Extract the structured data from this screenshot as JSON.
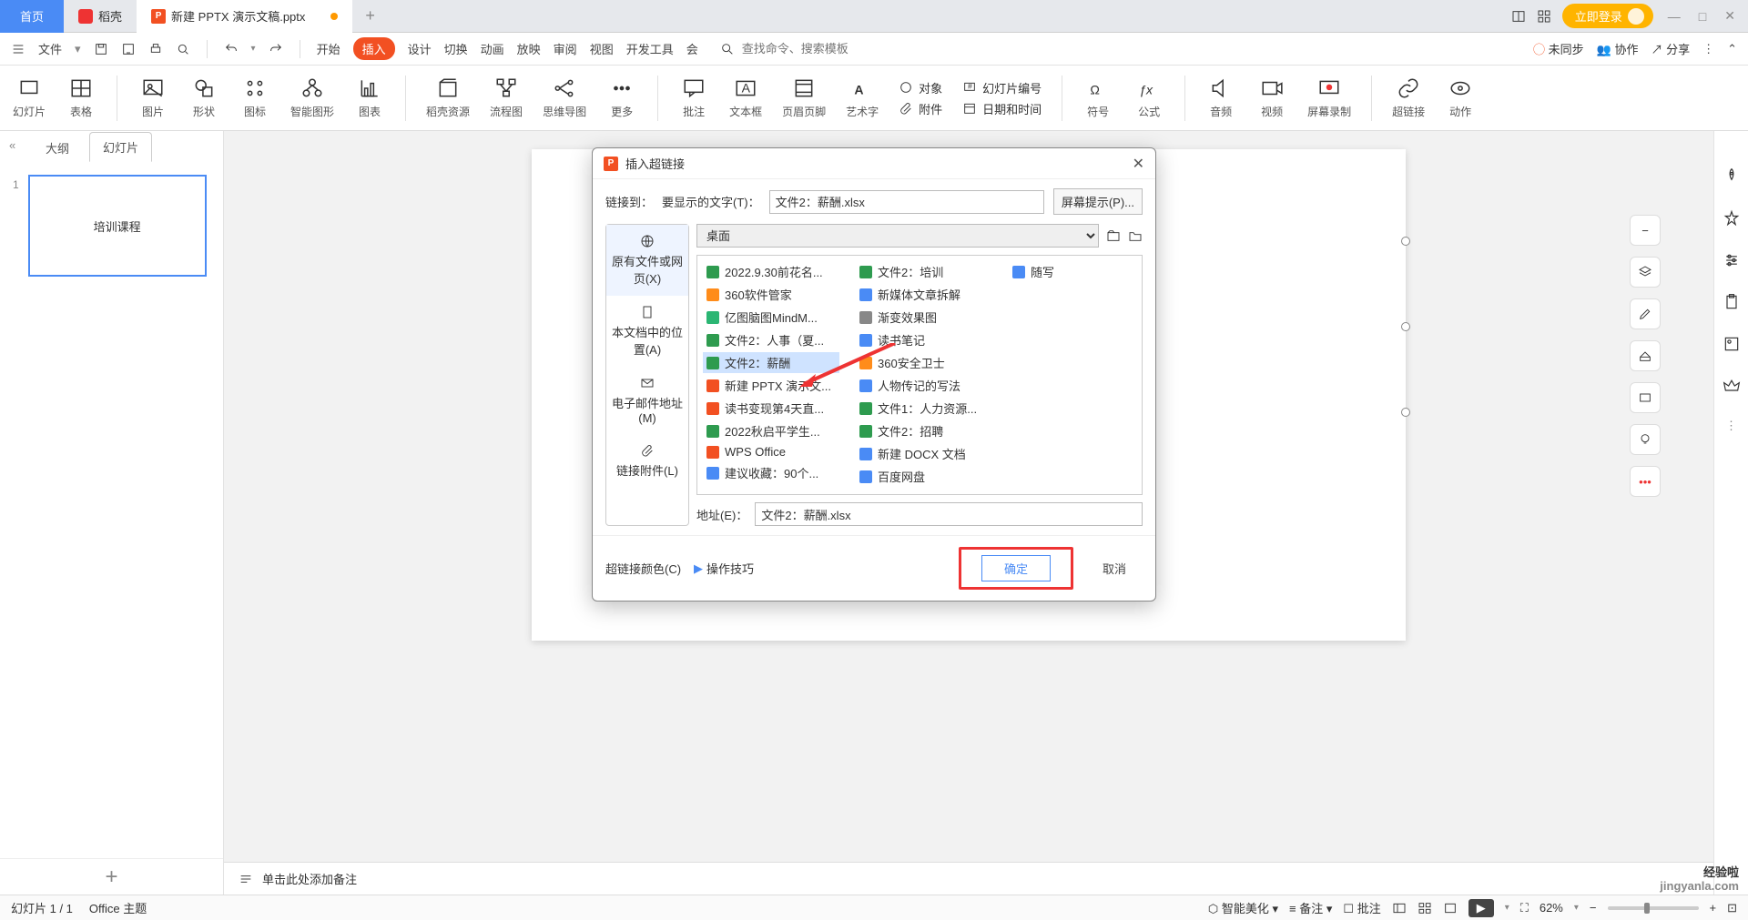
{
  "tabs": {
    "home": "首页",
    "docer": "稻壳",
    "doc": "新建 PPTX 演示文稿.pptx"
  },
  "titlebar": {
    "login": "立即登录"
  },
  "menu": {
    "file": "文件",
    "start": "开始",
    "insert": "插入",
    "design": "设计",
    "transition": "切换",
    "anim": "动画",
    "show": "放映",
    "review": "审阅",
    "view": "视图",
    "dev": "开发工具",
    "member": "会",
    "search_ph": "查找命令、搜索模板",
    "unsynced": "未同步",
    "collab": "协作",
    "share": "分享"
  },
  "ribbon": {
    "slide": "幻灯片",
    "table": "表格",
    "picture": "图片",
    "shape": "形状",
    "icon": "图标",
    "smart": "智能图形",
    "chart": "图表",
    "docer": "稻壳资源",
    "flow": "流程图",
    "mind": "思维导图",
    "more": "更多",
    "comment": "批注",
    "textbox": "文本框",
    "header": "页眉页脚",
    "wordart": "艺术字",
    "object": "对象",
    "slidenum": "幻灯片编号",
    "attach": "附件",
    "datetime": "日期和时间",
    "symbol": "符号",
    "equation": "公式",
    "audio": "音频",
    "video": "视频",
    "screenrec": "屏幕录制",
    "hyperlink": "超链接",
    "action": "动作"
  },
  "left": {
    "outline": "大纲",
    "slides": "幻灯片",
    "thumb_text": "培训课程",
    "num": "1"
  },
  "notes_ph": "单击此处添加备注",
  "status": {
    "slide": "幻灯片 1 / 1",
    "theme": "Office 主题",
    "beautify": "智能美化",
    "note": "备注",
    "review": "批注",
    "zoom": "62%"
  },
  "dialog": {
    "title": "插入超链接",
    "link_to": "链接到：",
    "display_lbl": "要显示的文字(T)：",
    "display_val": "文件2：薪酬.xlsx",
    "screen_tip": "屏幕提示(P)...",
    "tabs": {
      "a": "原有文件或网页(X)",
      "b": "本文档中的位置(A)",
      "c": "电子邮件地址(M)",
      "d": "链接附件(L)"
    },
    "loc": "桌面",
    "addr_lbl": "地址(E)：",
    "addr_val": "文件2：薪酬.xlsx",
    "link_color": "超链接颜色(C)",
    "tips": "操作技巧",
    "ok": "确定",
    "cancel": "取消",
    "files": [
      {
        "n": "2022.9.30前花名...",
        "c": "ic-x"
      },
      {
        "n": "360软件管家",
        "c": "ic-o"
      },
      {
        "n": "亿图脑图MindM...",
        "c": "ic-m"
      },
      {
        "n": "文件2：人事（夏...",
        "c": "ic-x"
      },
      {
        "n": "文件2：薪酬",
        "c": "ic-x",
        "sel": true
      },
      {
        "n": "新建 PPTX 演示文...",
        "c": "ic-p"
      },
      {
        "n": "读书变现第4天直...",
        "c": "ic-p"
      },
      {
        "n": "2022秋启平学生...",
        "c": "ic-x"
      },
      {
        "n": "WPS Office",
        "c": "ic-p"
      },
      {
        "n": "建议收藏：90个...",
        "c": "ic-w"
      },
      {
        "n": "文件2：培训",
        "c": "ic-x"
      },
      {
        "n": "新媒体文章拆解",
        "c": "ic-w"
      },
      {
        "n": "渐变效果图",
        "c": "ic-g"
      },
      {
        "n": "读书笔记",
        "c": "ic-w"
      },
      {
        "n": "360安全卫士",
        "c": "ic-o"
      },
      {
        "n": "人物传记的写法",
        "c": "ic-w"
      },
      {
        "n": "文件1：人力资源...",
        "c": "ic-x"
      },
      {
        "n": "文件2：招聘",
        "c": "ic-x"
      },
      {
        "n": "新建 DOCX 文档",
        "c": "ic-w"
      },
      {
        "n": "百度网盘",
        "c": "ic-w"
      },
      {
        "n": "随写",
        "c": "ic-w"
      }
    ]
  },
  "watermark": {
    "a": "经验啦",
    "b": "jingyanla.com"
  }
}
